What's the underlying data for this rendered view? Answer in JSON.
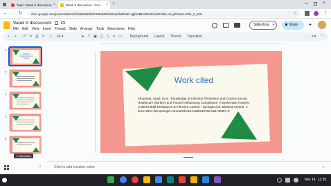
{
  "browser": {
    "tabs": [
      {
        "label": "Topic: Week 9 discussion",
        "active": false
      },
      {
        "label": "Week 9 discussion - Google Slides",
        "active": true
      }
    ],
    "new_tab": "+",
    "url": "docs.google.com/presentation/d/1bi6kW5d0ZCN6aW8k3I65vp3lsEl6xE-xgjDHBkCBKdS/edit#slide=id.g1f3c8e1c334_0_345"
  },
  "doc": {
    "title": "Week 9 discussion",
    "menu": [
      "File",
      "Edit",
      "View",
      "Insert",
      "Format",
      "Slide",
      "Arrange",
      "Tools",
      "Extensions",
      "Help"
    ],
    "slideshow_label": "Slideshow",
    "share_label": "Share"
  },
  "toolbar": {
    "fit_label": "Fit",
    "background_label": "Background",
    "layout_label": "Layout",
    "theme_label": "Theme",
    "transition_label": "Transition"
  },
  "filmstrip": {
    "slides": [
      {
        "num": "1",
        "text": "Infection Prevention and Control"
      },
      {
        "num": "2",
        "text": ""
      },
      {
        "num": "3",
        "text": ""
      },
      {
        "num": "4",
        "text": ""
      },
      {
        "num": "5",
        "text": ""
      }
    ],
    "tooltip": "7 total slides"
  },
  "slide": {
    "title": "Work cited",
    "citation": "Alhumaid, Saad, et al. “Knowledge of Infection Prevention and Control among Healthcare Workers and Factors Influencing Compliance: A Systematic Review - Antimicrobial Resistance & Infection Control.” SpringerLink, BioMed Central, 3 June 2021,link.springer.com/article/10.1186/s13756-021-00957-0."
  },
  "notes": {
    "placeholder": "Click to add speaker notes"
  },
  "taskbar": {
    "date": "Mar 14",
    "time": "11:35"
  },
  "colors": {
    "slide_bg": "#f4978e",
    "card_bg": "#fbf8ee",
    "accent_green": "#1e8c45",
    "title_blue": "#2b6cc4",
    "share_blue": "#c2e7ff"
  },
  "icons": [
    "search-icon",
    "undo-icon",
    "redo-icon",
    "print-icon",
    "zoom-icon",
    "cursor-icon",
    "textbox-icon",
    "image-icon",
    "shape-icon",
    "line-icon",
    "comment-icon",
    "star-icon",
    "history-icon",
    "chat-icon",
    "video-icon",
    "profile-avatar"
  ]
}
